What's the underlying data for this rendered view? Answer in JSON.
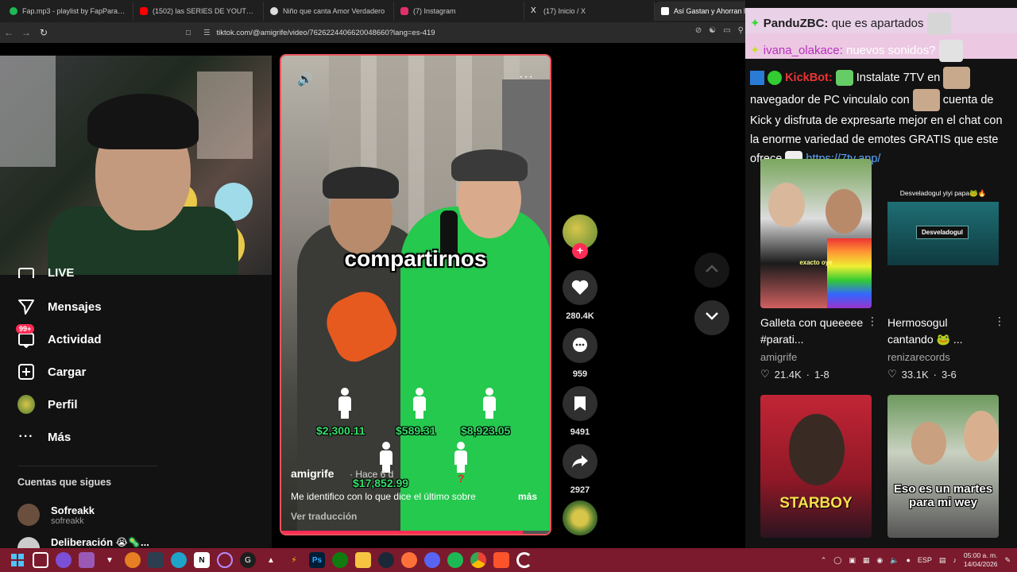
{
  "browser": {
    "tabs": [
      {
        "title": "Fap.mp3 - playlist by FapParaMoar | S",
        "color": "#1db954"
      },
      {
        "title": "(1502) las SERIES DE YOUTUBERS me",
        "color": "#ff0000"
      },
      {
        "title": "Niño que canta Amor Verdadero",
        "color": "#dddddd"
      },
      {
        "title": "(7) Instagram",
        "color": "#e1306c"
      },
      {
        "title": "(17) Inicio / X",
        "color": "#ffffff"
      },
      {
        "title": "Así Gastan y Ahorran lo",
        "color": "#ffffff"
      }
    ],
    "url": "tiktok.com/@amigrife/video/7626224406620048660?lang=es-419"
  },
  "sidebar": {
    "items": [
      {
        "label": "LIVE",
        "icon": "live-icon"
      },
      {
        "label": "Mensajes",
        "icon": "send-icon"
      },
      {
        "label": "Actividad",
        "icon": "inbox-icon",
        "badge": "99+"
      },
      {
        "label": "Cargar",
        "icon": "plus-square-icon"
      },
      {
        "label": "Perfil",
        "icon": "avatar"
      },
      {
        "label": "Más",
        "icon": "more-dots-icon"
      }
    ],
    "following_title": "Cuentas que sigues",
    "following": [
      {
        "name": "Sofreakk",
        "handle": "sofreakk"
      },
      {
        "name": "Deliberación 😭🦠...",
        "handle": ""
      }
    ]
  },
  "video": {
    "caption": "compartirnos",
    "amounts": [
      "$2,300.11",
      "$589.31",
      "$8,923.05",
      "$17,852.99"
    ],
    "question_mark": "?",
    "author": "amigrife",
    "time": "· Hace 6 d",
    "description": "Me identifico con lo que dice el último sobre",
    "more": "más",
    "translate": "Ver traducción",
    "progress": 0.9
  },
  "actions": {
    "likes": "280.4K",
    "comments": "959",
    "saves": "9491",
    "shares": "2927"
  },
  "chat": {
    "line1_name": "PanduZBC:",
    "line1_msg": "que es apartados",
    "line2_name": "ivana_olakace:",
    "line2_msg": "nuevos sonidos?",
    "kick_name": "KickBot:",
    "kick_text1": "Instalate 7TV en",
    "kick_text2": "navegador de PC vinculalo con",
    "kick_text3": "cuenta de Kick y disfruta de expresarte mejor en el chat con la enorme variedad de emotes GRATIS que este ofrece",
    "kick_link": "https://7tv.app/"
  },
  "recommended": [
    {
      "title": "Galleta con queeeee #parati...",
      "author": "amigrife",
      "likes": "21.4K",
      "extra": "1-8",
      "overlay": "exacto oye"
    },
    {
      "title": "Hermosogul cantando 🐸 ...",
      "author": "renizarecords",
      "likes": "33.1K",
      "extra": "3-6",
      "overlay": "Desveladogul yiyi papa🐸🔥",
      "overlay2": "Desveladogul"
    },
    {
      "title": "",
      "author": "",
      "likes": "",
      "extra": "",
      "overlay": "STARBOY"
    },
    {
      "title": "",
      "author": "",
      "likes": "",
      "extra": "",
      "overlay": "Eso es un martes para mi wey"
    }
  ],
  "taskbar": {
    "lang": "ESP",
    "time": "05:00 a. m.",
    "date": "14/04/2026"
  }
}
